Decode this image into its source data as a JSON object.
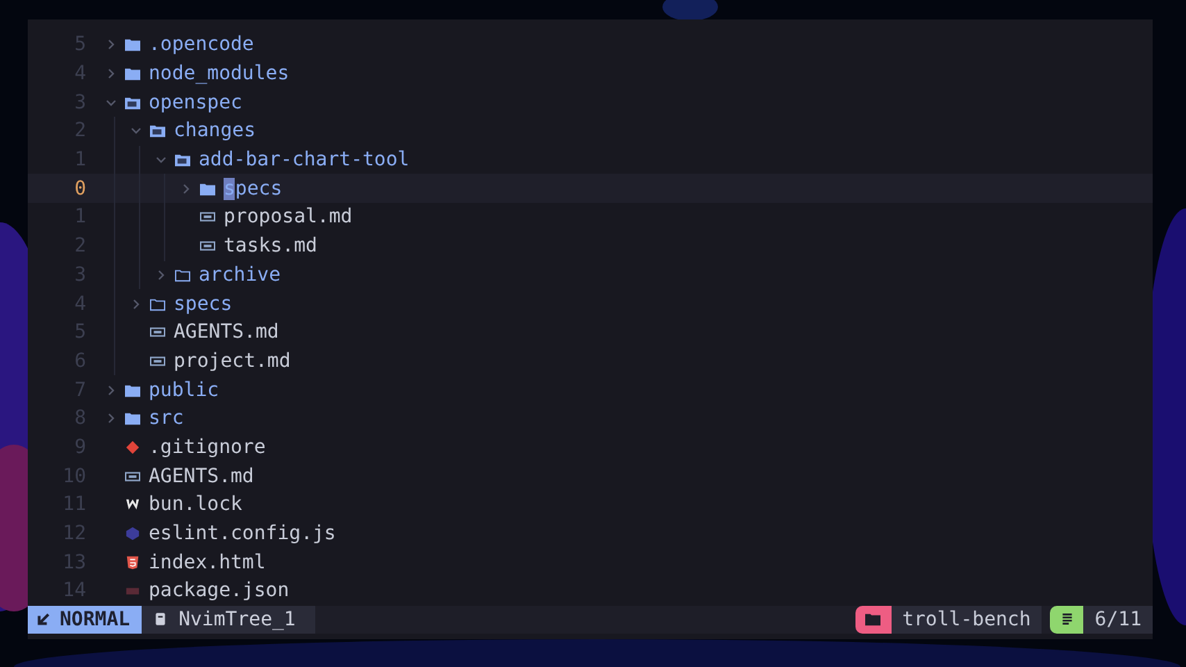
{
  "tree": [
    {
      "name": ".opencode",
      "kind": "folder",
      "expanded": false,
      "line_number": "5",
      "selected": false
    },
    {
      "name": "node_modules",
      "kind": "folder",
      "expanded": false,
      "line_number": "4",
      "selected": false
    },
    {
      "name": "openspec",
      "kind": "folder",
      "expanded": true,
      "line_number": "3",
      "selected": false,
      "children": [
        {
          "name": "changes",
          "kind": "folder",
          "expanded": true,
          "line_number": "2",
          "selected": false,
          "children": [
            {
              "name": "add-bar-chart-tool",
              "kind": "folder",
              "expanded": true,
              "line_number": "1",
              "selected": false,
              "children": [
                {
                  "name": "specs",
                  "kind": "folder",
                  "expanded": false,
                  "line_number": "0",
                  "selected": true
                },
                {
                  "name": "proposal.md",
                  "kind": "markdown",
                  "line_number": "1",
                  "selected": false
                },
                {
                  "name": "tasks.md",
                  "kind": "markdown",
                  "line_number": "2",
                  "selected": false
                }
              ]
            },
            {
              "name": "archive",
              "kind": "empty-folder",
              "expanded": false,
              "line_number": "3",
              "selected": false
            }
          ]
        },
        {
          "name": "specs",
          "kind": "empty-folder",
          "expanded": false,
          "line_number": "4",
          "selected": false
        },
        {
          "name": "AGENTS.md",
          "kind": "markdown",
          "line_number": "5",
          "selected": false
        },
        {
          "name": "project.md",
          "kind": "markdown",
          "line_number": "6",
          "selected": false
        }
      ]
    },
    {
      "name": "public",
      "kind": "folder",
      "expanded": false,
      "line_number": "7",
      "selected": false
    },
    {
      "name": "src",
      "kind": "folder",
      "expanded": false,
      "line_number": "8",
      "selected": false
    },
    {
      "name": ".gitignore",
      "kind": "git",
      "line_number": "9",
      "selected": false
    },
    {
      "name": "AGENTS.md",
      "kind": "markdown",
      "line_number": "10",
      "selected": false
    },
    {
      "name": "bun.lock",
      "kind": "lock",
      "line_number": "11",
      "selected": false
    },
    {
      "name": "eslint.config.js",
      "kind": "js",
      "line_number": "12",
      "selected": false
    },
    {
      "name": "index.html",
      "kind": "html",
      "line_number": "13",
      "selected": false
    },
    {
      "name": "package.json",
      "kind": "json",
      "line_number": "14",
      "selected": false
    }
  ],
  "status_bar": {
    "mode": "NORMAL",
    "buffer": "NvimTree_1",
    "project": "troll-bench",
    "position": "6/11"
  }
}
